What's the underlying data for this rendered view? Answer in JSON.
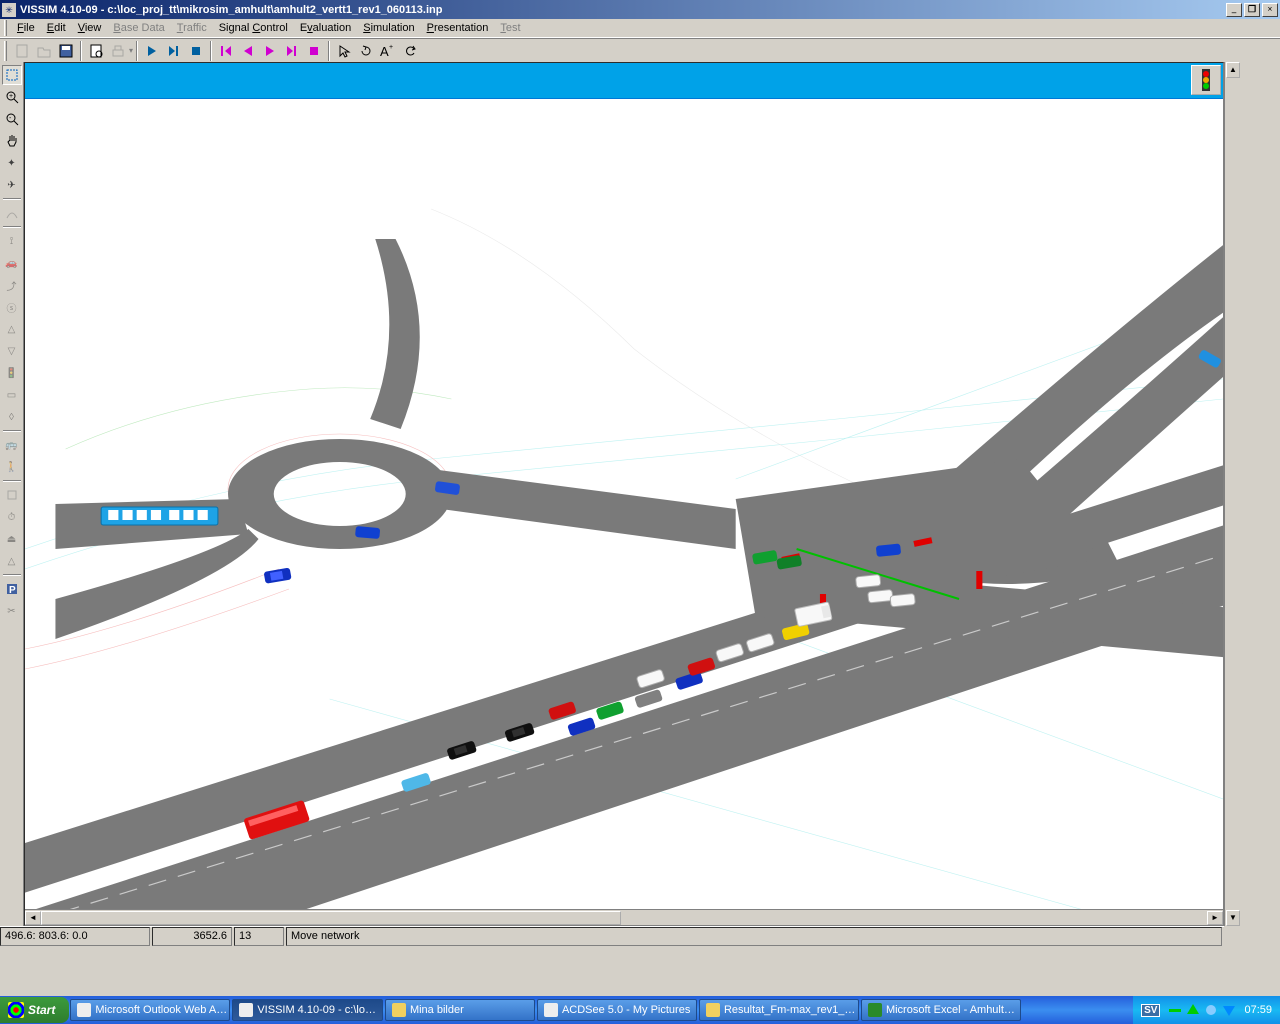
{
  "title": "VISSIM 4.10-09 - c:\\loc_proj_tt\\mikrosim_amhult\\amhult2_vertt1_rev1_060113.inp",
  "menu": {
    "file": "File",
    "edit": "Edit",
    "view": "View",
    "basedata": "Base Data",
    "traffic": "Traffic",
    "signal": "Signal Control",
    "evaluation": "Evaluation",
    "simulation": "Simulation",
    "presentation": "Presentation",
    "test": "Test"
  },
  "status": {
    "coords": "496.6: 803.6: 0.0",
    "value2": "3652.6",
    "value3": "13",
    "message": "Move network"
  },
  "taskbar": {
    "start": "Start",
    "tasks": [
      "Microsoft Outlook Web A…",
      "VISSIM 4.10-09 - c:\\lo…",
      "Mina bilder",
      "ACDSee 5.0 - My Pictures",
      "Resultat_Fm-max_rev1_…",
      "Microsoft Excel - Amhult…"
    ],
    "lang": "SV",
    "clock": "07:59"
  }
}
